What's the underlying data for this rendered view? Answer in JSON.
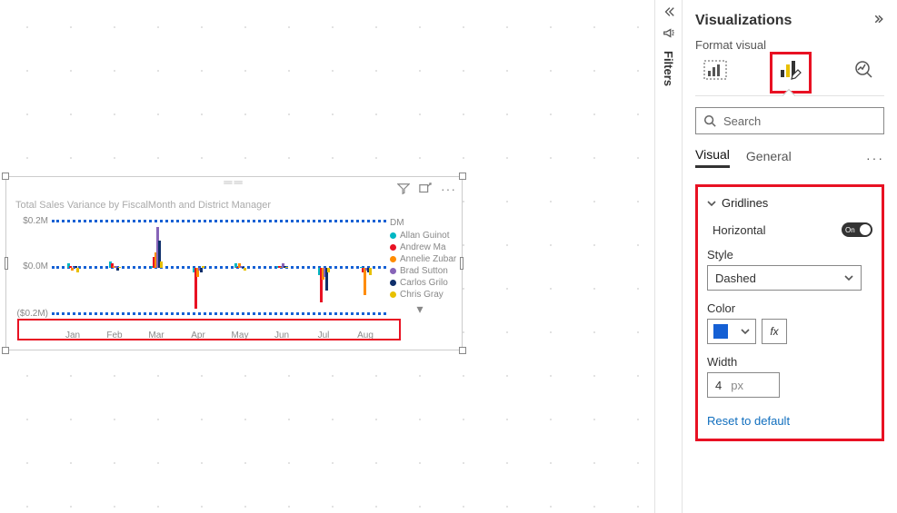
{
  "pane": {
    "title": "Visualizations",
    "format_label": "Format visual",
    "search_placeholder": "Search",
    "tab_visual": "Visual",
    "tab_general": "General",
    "section_gridlines": "Gridlines",
    "section_horizontal": "Horizontal",
    "toggle_on": "On",
    "style_label": "Style",
    "style_value": "Dashed",
    "color_label": "Color",
    "color_hex": "#1560d4",
    "fx_label": "fx",
    "width_label": "Width",
    "width_value": "4",
    "width_unit": "px",
    "reset_label": "Reset to default"
  },
  "filters": {
    "label": "Filters"
  },
  "chart": {
    "title": "Total Sales Variance by FiscalMonth and District Manager",
    "legend_title": "DM",
    "legend": [
      {
        "name": "Allan Guinot",
        "color": "#00b7c3"
      },
      {
        "name": "Andrew Ma",
        "color": "#e81123"
      },
      {
        "name": "Annelie Zubar",
        "color": "#ff8c00"
      },
      {
        "name": "Brad Sutton",
        "color": "#8764b8"
      },
      {
        "name": "Carlos Grilo",
        "color": "#0f2f6b"
      },
      {
        "name": "Chris Gray",
        "color": "#e8c000"
      }
    ],
    "y_ticks": [
      "$0.2M",
      "$0.0M",
      "($0.2M)"
    ],
    "x_labels": [
      "Jan",
      "Feb",
      "Mar",
      "Apr",
      "May",
      "Jun",
      "Jul",
      "Aug"
    ]
  },
  "chart_data": {
    "type": "bar",
    "title": "Total Sales Variance by FiscalMonth and District Manager",
    "xlabel": "FiscalMonth",
    "ylabel": "Total Sales Variance",
    "ylim": [
      -0.2,
      0.2
    ],
    "y_unit": "$M",
    "categories": [
      "Jan",
      "Feb",
      "Mar",
      "Apr",
      "May",
      "Jun",
      "Jul",
      "Aug"
    ],
    "series": [
      {
        "name": "Allan Guinot",
        "color": "#00b7c3",
        "values": [
          0.02,
          0.03,
          0.01,
          -0.02,
          0.02,
          0.01,
          -0.03,
          0.0
        ]
      },
      {
        "name": "Andrew Ma",
        "color": "#e81123",
        "values": [
          0.01,
          0.02,
          0.05,
          -0.18,
          0.0,
          0.01,
          -0.15,
          -0.02
        ]
      },
      {
        "name": "Annelie Zubar",
        "color": "#ff8c00",
        "values": [
          -0.01,
          0.01,
          0.07,
          -0.04,
          0.02,
          0.0,
          -0.05,
          -0.12
        ]
      },
      {
        "name": "Brad Sutton",
        "color": "#8764b8",
        "values": [
          0.0,
          0.01,
          0.18,
          -0.01,
          0.01,
          0.02,
          -0.04,
          -0.01
        ]
      },
      {
        "name": "Carlos Grilo",
        "color": "#0f2f6b",
        "values": [
          0.01,
          -0.01,
          0.12,
          -0.02,
          0.0,
          0.01,
          -0.1,
          -0.02
        ]
      },
      {
        "name": "Chris Gray",
        "color": "#e8c000",
        "values": [
          -0.02,
          0.0,
          0.03,
          0.01,
          -0.01,
          0.0,
          -0.02,
          -0.03
        ]
      }
    ]
  }
}
